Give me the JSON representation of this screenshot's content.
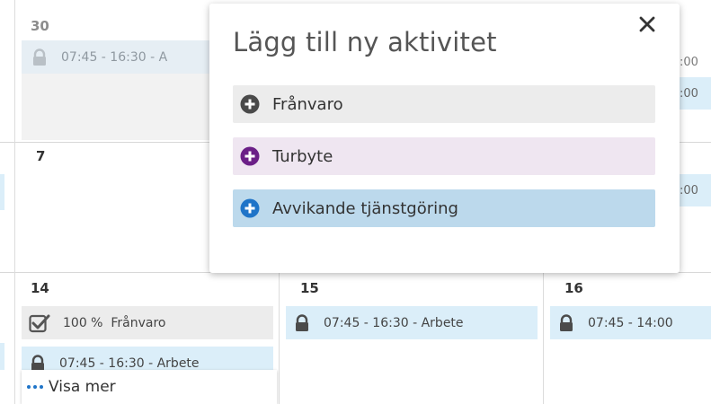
{
  "calendar": {
    "rows": [
      {
        "cells": [
          {
            "day": "30",
            "muted": true,
            "events": [
              {
                "kind": "work",
                "muted": true,
                "text": "07:45 - 16:30 - A"
              }
            ]
          },
          {
            "day": "",
            "events": []
          },
          {
            "day": "",
            "events": [
              {
                "clipped": ":00"
              },
              {
                "clipped": ":00"
              }
            ]
          }
        ]
      },
      {
        "cells": [
          {
            "day": "7",
            "events": []
          },
          {
            "day": "",
            "events": []
          },
          {
            "day": "",
            "events": [
              {
                "clipped": ":00"
              }
            ]
          }
        ]
      },
      {
        "cells": [
          {
            "day": "14",
            "events": [
              {
                "kind": "absence",
                "text": "100 %  Frånvaro"
              },
              {
                "kind": "work",
                "text": "07:45 - 16:30 - Arbete"
              }
            ]
          },
          {
            "day": "15",
            "events": [
              {
                "kind": "work",
                "text": "07:45 - 16:30 - Arbete"
              }
            ]
          },
          {
            "day": "16",
            "events": [
              {
                "kind": "work",
                "text": "07:45 - 14:00"
              }
            ]
          }
        ]
      }
    ],
    "show_more": "Visa mer"
  },
  "modal": {
    "title": "Lägg till ny aktivitet",
    "close_icon": "close-icon",
    "options": [
      {
        "label": "Frånvaro",
        "bg": "#ececec",
        "icon_color": "#4a4a4a",
        "icon": "plus-circle-icon"
      },
      {
        "label": "Turbyte",
        "bg": "#efe6f1",
        "icon_color": "#6b1f87",
        "icon": "plus-circle-icon"
      },
      {
        "label": "Avvikande tjänstgöring",
        "bg": "#bcd9ec",
        "icon_color": "#1f74c8",
        "icon": "plus-circle-icon"
      }
    ]
  },
  "colors": {
    "work_event": "#dbeef9",
    "absence_event": "#ececec",
    "accent": "#1f74c8"
  }
}
